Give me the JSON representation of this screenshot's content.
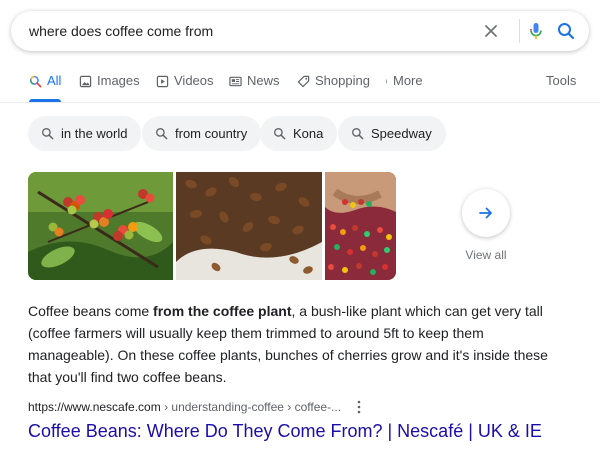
{
  "search": {
    "query": "where does coffee come from",
    "icons": [
      "clear-icon",
      "mic-icon",
      "search-icon"
    ]
  },
  "tabs": [
    {
      "label": "All",
      "icon": "search-icon",
      "active": true
    },
    {
      "label": "Images",
      "icon": "image-icon",
      "active": false
    },
    {
      "label": "Videos",
      "icon": "video-icon",
      "active": false
    },
    {
      "label": "News",
      "icon": "news-icon",
      "active": false
    },
    {
      "label": "Shopping",
      "icon": "tag-icon",
      "active": false
    },
    {
      "label": "More",
      "icon": "more-vert-icon",
      "active": false
    }
  ],
  "tools_label": "Tools",
  "chips": [
    {
      "label": "in the world"
    },
    {
      "label": "from country"
    },
    {
      "label": "Kona"
    },
    {
      "label": "Speedway"
    }
  ],
  "images": {
    "tiles": [
      "coffee-cherries-on-branch",
      "roasted-coffee-beans",
      "hands-holding-coffee-cherries"
    ],
    "view_all_label": "View all"
  },
  "snippet": {
    "before": "Coffee beans come ",
    "bold": "from the coffee plant",
    "after": ", a bush-like plant which can get very tall (coffee farmers will usually keep them trimmed to around 5ft to keep them manageable). On these coffee plants, bunches of cherries grow and it's inside these that you'll find two coffee beans."
  },
  "result": {
    "domain": "https://www.nescafe.com",
    "path": " › understanding-coffee › coffee-...",
    "title": "Coffee Beans: Where Do They Come From? | Nescafé | UK & IE"
  },
  "colors": {
    "accent_blue": "#1a73e8",
    "link_title": "#1a0dab",
    "chip_bg": "#f1f3f4",
    "muted_text": "#5f6368"
  }
}
